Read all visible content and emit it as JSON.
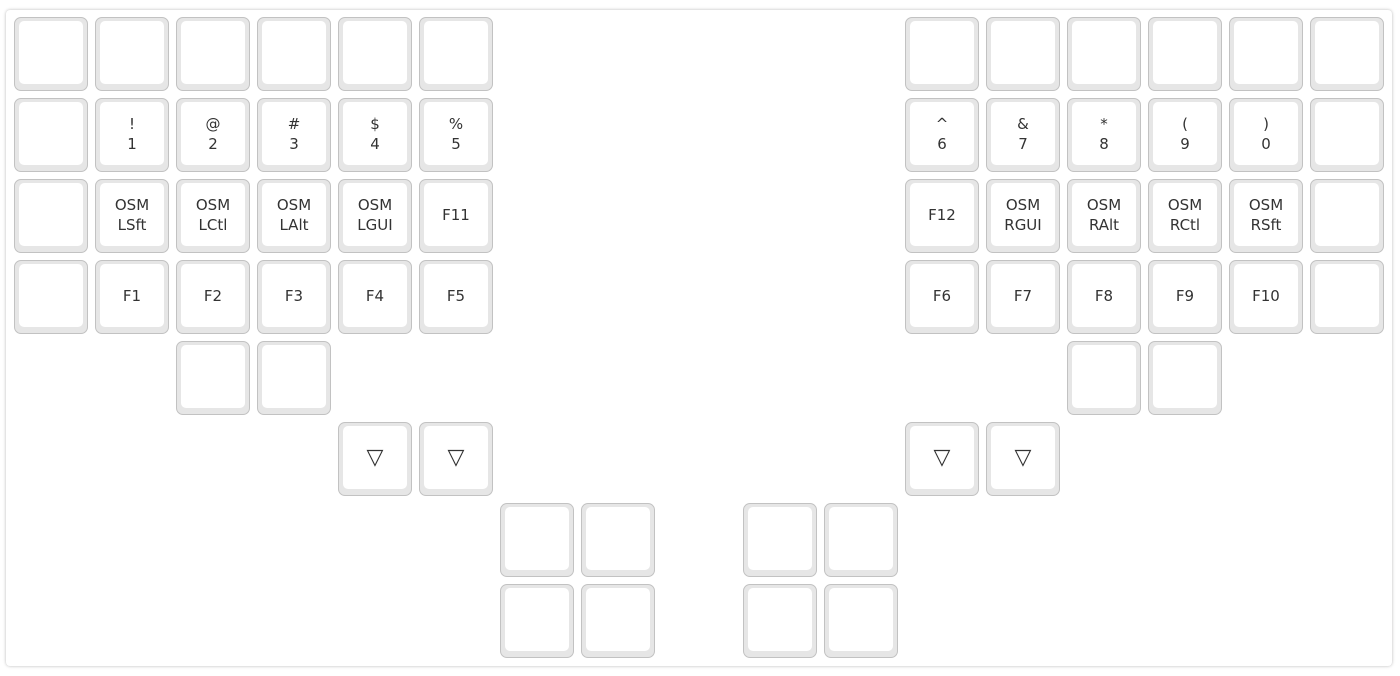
{
  "keyboard": {
    "left": {
      "row0": [
        "",
        "",
        "",
        "",
        "",
        ""
      ],
      "row1": [
        {
          "shift": "",
          "base": ""
        },
        {
          "shift": "!",
          "base": "1"
        },
        {
          "shift": "@",
          "base": "2"
        },
        {
          "shift": "#",
          "base": "3"
        },
        {
          "shift": "$",
          "base": "4"
        },
        {
          "shift": "%",
          "base": "5"
        }
      ],
      "row2": [
        {
          "l1": "",
          "l2": ""
        },
        {
          "l1": "OSM",
          "l2": "LSft"
        },
        {
          "l1": "OSM",
          "l2": "LCtl"
        },
        {
          "l1": "OSM",
          "l2": "LAlt"
        },
        {
          "l1": "OSM",
          "l2": "LGUI"
        },
        {
          "l1": "F11",
          "l2": ""
        }
      ],
      "row3": [
        "",
        "F1",
        "F2",
        "F3",
        "F4",
        "F5"
      ],
      "row4": [
        "",
        ""
      ],
      "thumb_trans": [
        "▽",
        "▽"
      ],
      "thumb_cluster": [
        "",
        "",
        "",
        ""
      ]
    },
    "right": {
      "row0": [
        "",
        "",
        "",
        "",
        "",
        ""
      ],
      "row1": [
        {
          "shift": "^",
          "base": "6"
        },
        {
          "shift": "&",
          "base": "7"
        },
        {
          "shift": "*",
          "base": "8"
        },
        {
          "shift": "(",
          "base": "9"
        },
        {
          "shift": ")",
          "base": "0"
        },
        {
          "shift": "",
          "base": ""
        }
      ],
      "row2": [
        {
          "l1": "F12",
          "l2": ""
        },
        {
          "l1": "OSM",
          "l2": "RGUI"
        },
        {
          "l1": "OSM",
          "l2": "RAlt"
        },
        {
          "l1": "OSM",
          "l2": "RCtl"
        },
        {
          "l1": "OSM",
          "l2": "RSft"
        },
        {
          "l1": "",
          "l2": ""
        }
      ],
      "row3": [
        "F6",
        "F7",
        "F8",
        "F9",
        "F10",
        ""
      ],
      "row4": [
        "",
        ""
      ],
      "thumb_trans": [
        "▽",
        "▽"
      ],
      "thumb_cluster": [
        "",
        "",
        "",
        ""
      ]
    }
  }
}
